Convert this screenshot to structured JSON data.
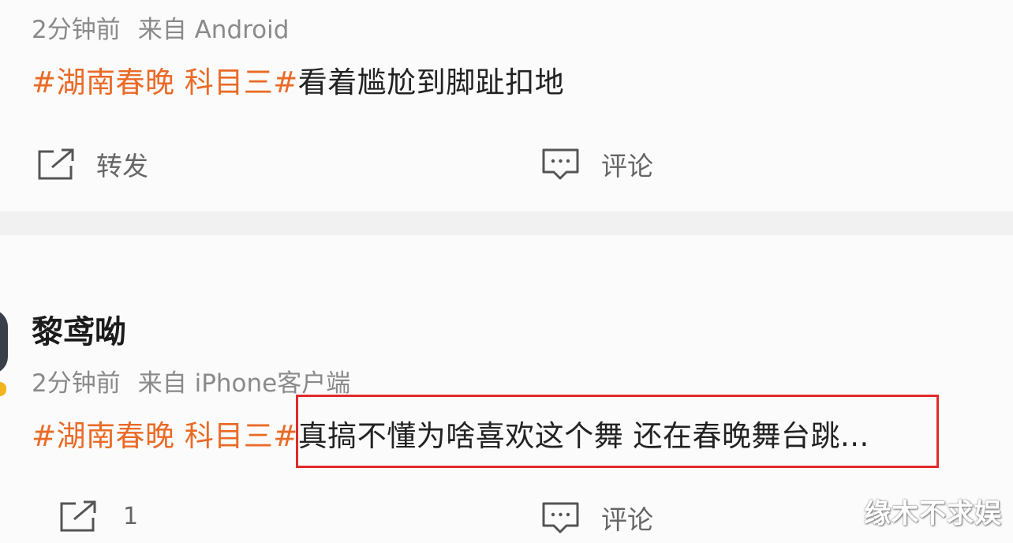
{
  "post1": {
    "time": "2分钟前",
    "source": "来自 Android",
    "topic": "#湖南春晚 科目三#",
    "text": "看着尴尬到脚趾扣地",
    "repost_label": "转发",
    "comment_label": "评论"
  },
  "post2": {
    "username": "黎鸢呦",
    "time": "2分钟前",
    "source": "来自 iPhone客户端",
    "topic": "#湖南春晚 科目三#",
    "text": "真搞不懂为啥喜欢这个舞 还在春晚舞台跳...",
    "repost_count": "1",
    "comment_label": "评论"
  },
  "watermark": "缘木不求娱",
  "colors": {
    "topic": "#ea6a26",
    "highlight_box": "#e12b2b",
    "verified_badge": "#f2b41c"
  },
  "icons": {
    "repost": "share-arrow-icon",
    "comment": "speech-bubble-icon"
  }
}
